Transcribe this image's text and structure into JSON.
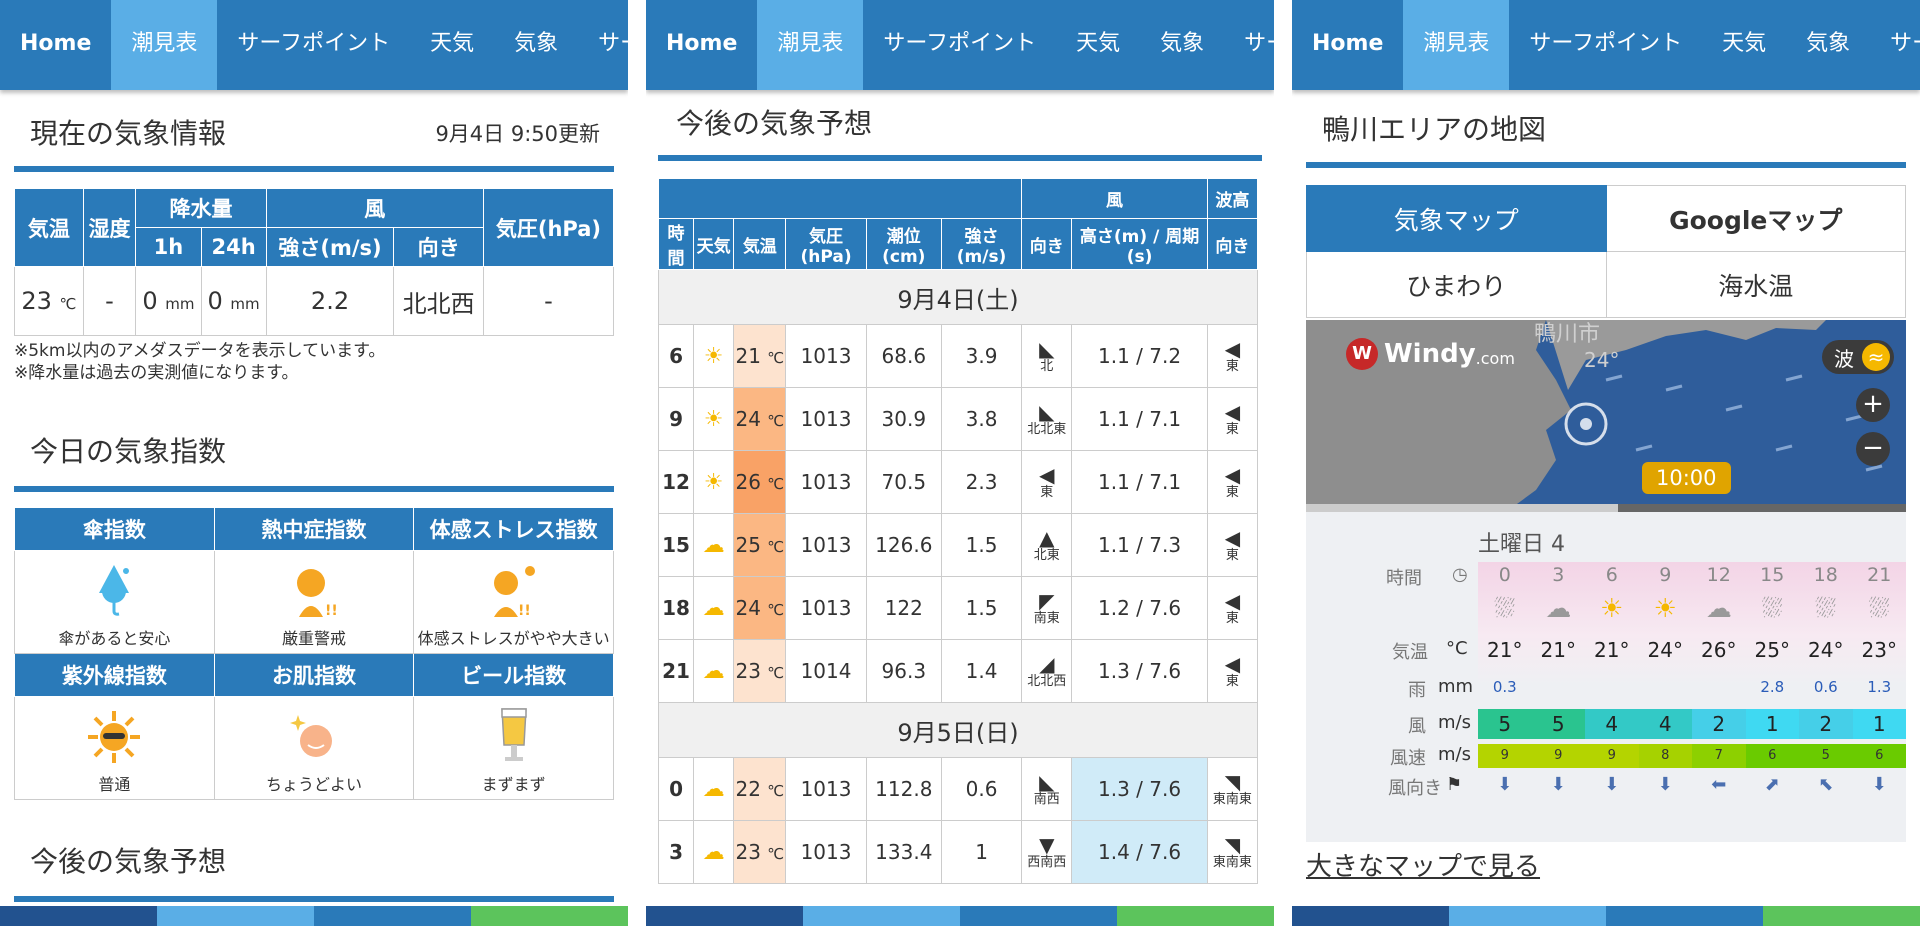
{
  "nav": [
    "Home",
    "潮見表",
    "サーフポイント",
    "天気",
    "気象",
    "サーフ"
  ],
  "current": {
    "title": "現在の気象情報",
    "updated": "9月4日 9:50更新",
    "headers": {
      "temp": "気温",
      "humidity": "湿度",
      "rain": "降水量",
      "rain_1h": "1h",
      "rain_24h": "24h",
      "wind": "風",
      "wind_speed": "強さ(m/s)",
      "wind_dir": "向き",
      "pressure": "気圧(hPa)"
    },
    "values": {
      "temp": "23",
      "temp_unit": "℃",
      "humidity": "-",
      "rain_1h": "0",
      "rain_24h": "0",
      "rain_unit": "mm",
      "wind_speed": "2.2",
      "wind_dir": "北北西",
      "pressure": "-"
    },
    "notes": [
      "※5km以内のアメダスデータを表示しています。",
      "※降水量は過去の実測値になります。"
    ]
  },
  "indices": {
    "title": "今日の気象指数",
    "items": [
      {
        "name": "傘指数",
        "value": "傘があると安心",
        "icon": "umbrella-icon"
      },
      {
        "name": "熱中症指数",
        "value": "厳重警戒",
        "icon": "heatstroke-icon"
      },
      {
        "name": "体感ストレス指数",
        "value": "体感ストレスがやや大きい",
        "icon": "stress-icon"
      },
      {
        "name": "紫外線指数",
        "value": "普通",
        "icon": "sun-icon"
      },
      {
        "name": "お肌指数",
        "value": "ちょうどよい",
        "icon": "skin-icon"
      },
      {
        "name": "ビール指数",
        "value": "まずまず",
        "icon": "beer-icon"
      }
    ]
  },
  "forecast": {
    "title": "今後の気象予想",
    "group_headers": {
      "wind": "風",
      "wave": "波高"
    },
    "headers": [
      "時間",
      "天気",
      "気温",
      "気圧(hPa)",
      "潮位(cm)",
      "強さ(m/s)",
      "向き",
      "高さ(m) / 周期(s)",
      "向き"
    ],
    "temp_unit": "℃",
    "days": [
      {
        "label": "9月4日(土)",
        "rows": [
          {
            "h": "6",
            "t": "21",
            "p": "1013",
            "tide": "68.6",
            "ws": "3.9",
            "wd": "北",
            "wave": "1.1 / 7.2",
            "wvd": "東"
          },
          {
            "h": "9",
            "t": "24",
            "p": "1013",
            "tide": "30.9",
            "ws": "3.8",
            "wd": "北北東",
            "wave": "1.1 / 7.1",
            "wvd": "東"
          },
          {
            "h": "12",
            "t": "26",
            "p": "1013",
            "tide": "70.5",
            "ws": "2.3",
            "wd": "東",
            "wave": "1.1 / 7.1",
            "wvd": "東"
          },
          {
            "h": "15",
            "t": "25",
            "p": "1013",
            "tide": "126.6",
            "ws": "1.5",
            "wd": "北東",
            "wave": "1.1 / 7.3",
            "wvd": "東"
          },
          {
            "h": "18",
            "t": "24",
            "p": "1013",
            "tide": "122",
            "ws": "1.5",
            "wd": "南東",
            "wave": "1.2 / 7.6",
            "wvd": "東"
          },
          {
            "h": "21",
            "t": "23",
            "p": "1014",
            "tide": "96.3",
            "ws": "1.4",
            "wd": "北北西",
            "wave": "1.3 / 7.6",
            "wvd": "東"
          }
        ]
      },
      {
        "label": "9月5日(日)",
        "rows": [
          {
            "h": "0",
            "t": "22",
            "p": "1013",
            "tide": "112.8",
            "ws": "0.6",
            "wd": "南西",
            "wave": "1.3 / 7.6",
            "wvd": "東南東"
          },
          {
            "h": "3",
            "t": "23",
            "p": "1013",
            "tide": "133.4",
            "ws": "1",
            "wd": "西南西",
            "wave": "1.4 / 7.6",
            "wvd": "東南東"
          }
        ]
      }
    ]
  },
  "map": {
    "title": "鴨川エリアの地図",
    "tabs": [
      "気象マップ",
      "Googleマップ",
      "ひまわり",
      "海水温"
    ],
    "brand": "Windy",
    "brand_suffix": ".com",
    "city": "鴨川市",
    "city_temp": "24°",
    "layer": "波",
    "time": "10:00",
    "day": "土曜日 4",
    "labels": {
      "time": "時間",
      "temp": "気温",
      "temp_unit": "°C",
      "rain": "雨",
      "rain_unit": "mm",
      "wind": "風",
      "wind_unit": "m/s",
      "gust": "風速",
      "gust_unit": "m/s",
      "dir": "風向き"
    },
    "hours": [
      "0",
      "3",
      "6",
      "9",
      "12",
      "15",
      "18",
      "21"
    ],
    "temps": [
      "21°",
      "21°",
      "21°",
      "24°",
      "26°",
      "25°",
      "24°",
      "23°"
    ],
    "rain": [
      "0.3",
      "",
      "",
      "",
      "",
      "2.8",
      "0.6",
      "1.3"
    ],
    "wind": [
      "5",
      "5",
      "4",
      "4",
      "2",
      "1",
      "2",
      "1"
    ],
    "gust": [
      "9",
      "9",
      "9",
      "8",
      "7",
      "6",
      "5",
      "6"
    ],
    "link": "大きなマップで見る"
  }
}
